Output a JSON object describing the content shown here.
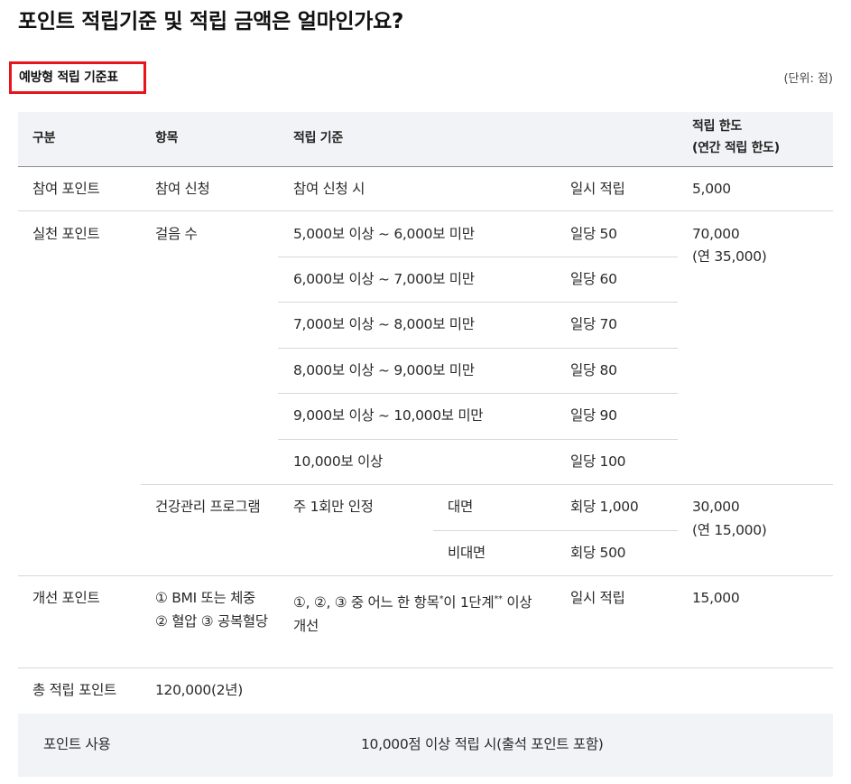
{
  "title": "포인트 적립기준 및 적립 금액은 얼마인가요?",
  "section_label": "예방형 적립 기준표",
  "unit": "(단위: 점)",
  "headers": {
    "category": "구분",
    "item": "항목",
    "criteria": "적립 기준",
    "limit_line1": "적립 한도",
    "limit_line2": "(연간 적립 한도)"
  },
  "participation": {
    "category": "참여 포인트",
    "item": "참여 신청",
    "criteria": "참여 신청 시",
    "amount": "일시 적립",
    "limit": "5,000"
  },
  "practice": {
    "category": "실천 포인트",
    "steps": {
      "item": "걸음 수",
      "rows": [
        {
          "criteria": "5,000보 이상 ~ 6,000보 미만",
          "amount": "일당 50"
        },
        {
          "criteria": "6,000보 이상 ~ 7,000보 미만",
          "amount": "일당 60"
        },
        {
          "criteria": "7,000보 이상 ~ 8,000보 미만",
          "amount": "일당 70"
        },
        {
          "criteria": "8,000보 이상 ~ 9,000보 미만",
          "amount": "일당 80"
        },
        {
          "criteria": "9,000보 이상 ~ 10,000보 미만",
          "amount": "일당 90"
        },
        {
          "criteria": "10,000보 이상",
          "amount": "일당 100"
        }
      ],
      "limit_line1": "70,000",
      "limit_line2": "(연 35,000)"
    },
    "program": {
      "item": "건강관리 프로그램",
      "criteria": "주 1회만 인정",
      "rows": [
        {
          "mode": "대면",
          "amount": "회당 1,000"
        },
        {
          "mode": "비대면",
          "amount": "회당 500"
        }
      ],
      "limit_line1": "30,000",
      "limit_line2": "(연 15,000)"
    }
  },
  "improvement": {
    "category": "개선 포인트",
    "item": "① BMI 또는 체중 ② 혈압 ③ 공복혈당",
    "criteria_prefix": "①, ②, ③ 중 어느 한 항목",
    "criteria_sup1": "*",
    "criteria_mid": "이 1단계",
    "criteria_sup2": "**",
    "criteria_suffix": " 이상 개선",
    "amount": "일시 적립",
    "limit": "15,000"
  },
  "total": {
    "category": "총 적립 포인트",
    "value": "120,000(2년)"
  },
  "usage": {
    "category": "포인트 사용",
    "value": "10,000점 이상 적립 시(출석 포인트 포함)"
  }
}
